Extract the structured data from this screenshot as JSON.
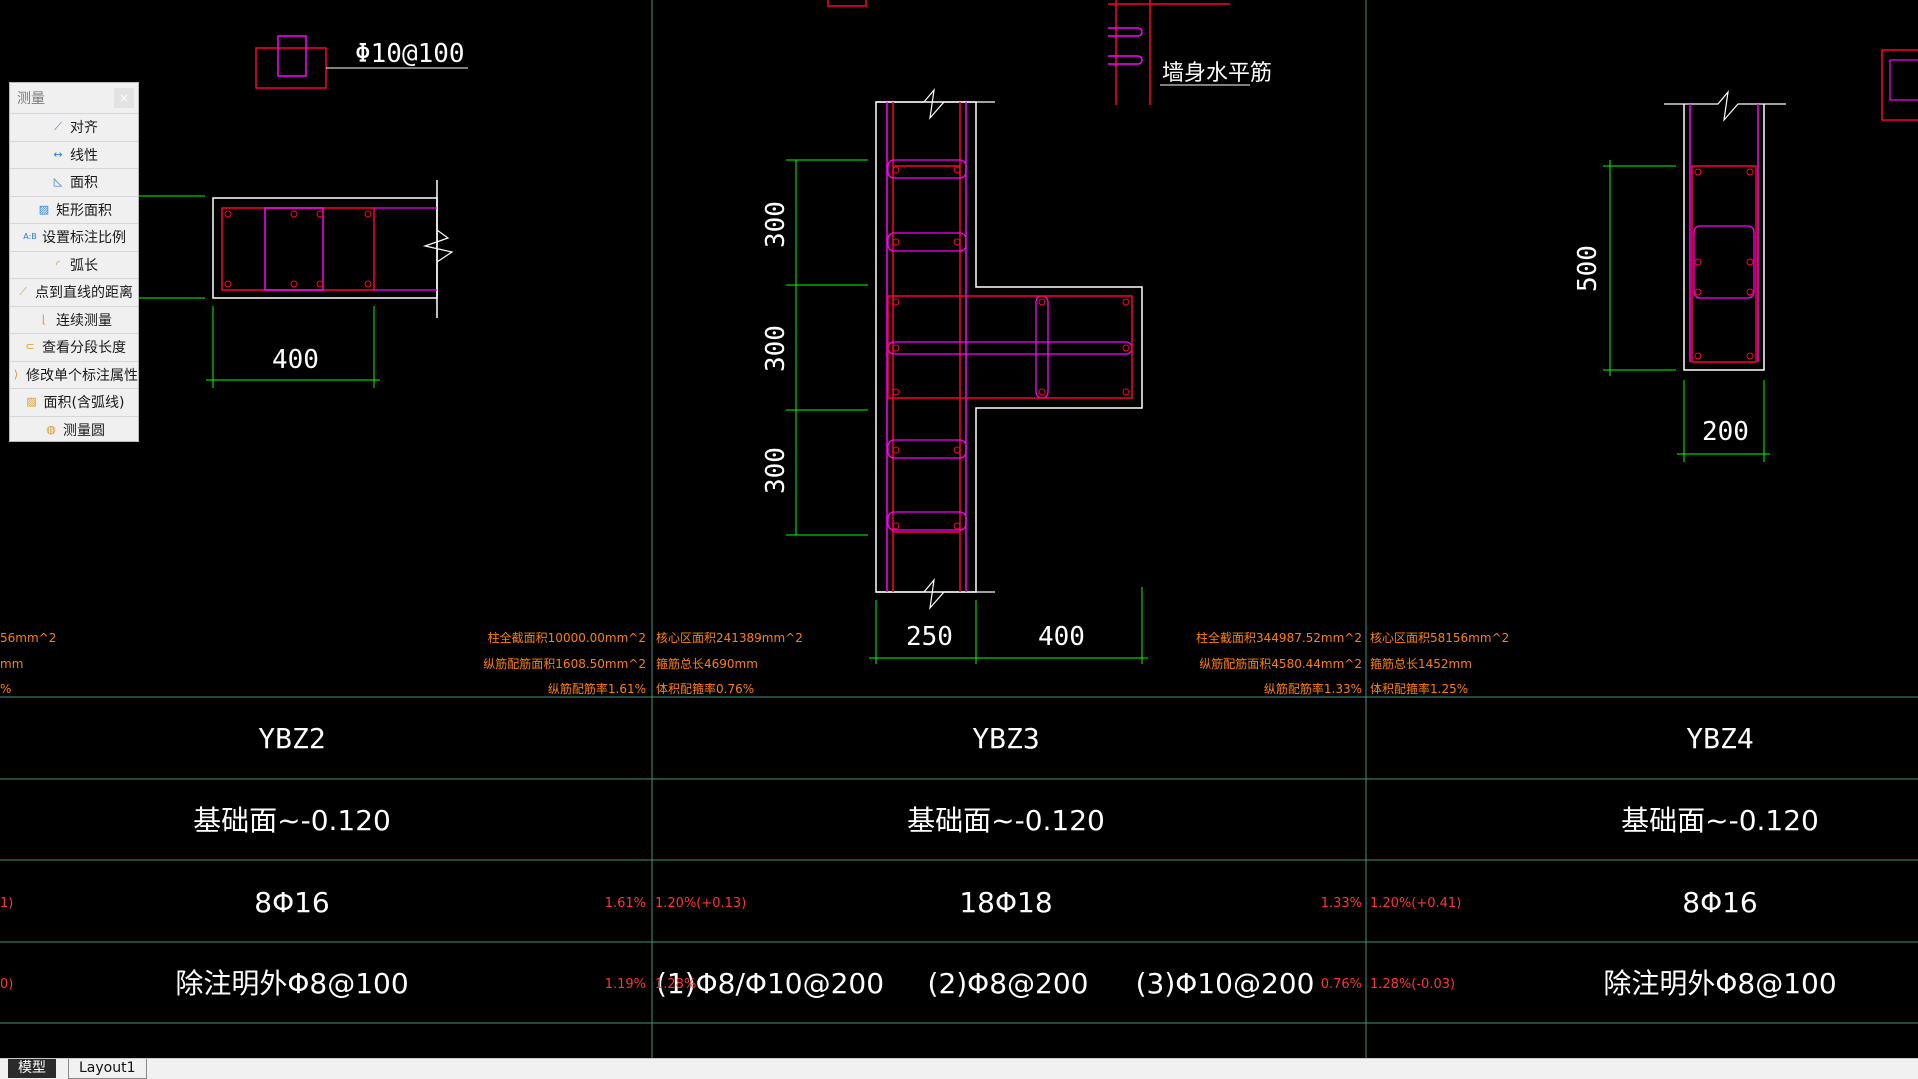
{
  "drawing": {
    "ybz2": {
      "dim_label": "Φ10@100",
      "width": "400",
      "stats": [
        "柱全截面积10000.00mm^2",
        "纵筋配筋面积1608.50mm^2",
        "纵筋配筋率1.61%"
      ]
    },
    "ybz3": {
      "dims": [
        "300",
        "300",
        "300",
        "250",
        "400"
      ],
      "stats_left": [
        "核心区面积241389mm^2",
        "箍筋总长4690mm",
        "体积配箍率0.76%"
      ],
      "note": "墙身水平筋",
      "stats": [
        "柱全截面积344987.52mm^2",
        "纵筋配筋面积4580.44mm^2",
        "纵筋配筋率1.33%"
      ]
    },
    "ybz4": {
      "dims": [
        "500",
        "200"
      ],
      "stats_left": [
        "核心区面积58156mm^2",
        "箍筋总长1452mm",
        "体积配箍率1.25%"
      ]
    },
    "left_edge": [
      "56mm^2",
      "mm",
      "%"
    ]
  },
  "table": {
    "names": [
      "YBZ2",
      "YBZ3",
      "YBZ4"
    ],
    "elevations": [
      "基础面~-0.120",
      "基础面~-0.120",
      "基础面~-0.120"
    ],
    "rebars": [
      "8Φ16",
      "18Φ18",
      "8Φ16"
    ],
    "stirrups": [
      "除注明外Φ8@100",
      "(1)Φ8/Φ10@200",
      "(2)Φ8@200",
      "(3)Φ10@200",
      "除注明外Φ8@100"
    ],
    "small_red": {
      "r3_a": "1.61%",
      "r3_b": "1.20%(+0.13)",
      "r3_c": "1.33%",
      "r3_d": "1.20%(+0.41)",
      "r4_a": "1.19%",
      "r4_b": "1.28%",
      "r4_c": "0.76%",
      "r4_d": "1.28%(-0.03)"
    },
    "edge_marks": [
      "1)",
      "0)"
    ]
  },
  "measure_panel": {
    "title": "测量",
    "close": "×",
    "items": [
      {
        "label": "对齐",
        "icon": "align-icon"
      },
      {
        "label": "线性",
        "icon": "linear-icon"
      },
      {
        "label": "面积",
        "icon": "area-icon"
      },
      {
        "label": "矩形面积",
        "icon": "rect-area-icon"
      },
      {
        "label": "设置标注比例",
        "icon": "scale-icon"
      },
      {
        "label": "弧长",
        "icon": "arc-icon"
      },
      {
        "label": "点到直线的距离",
        "icon": "point-line-icon"
      },
      {
        "label": "连续测量",
        "icon": "continuous-icon"
      },
      {
        "label": "查看分段长度",
        "icon": "segment-icon"
      },
      {
        "label": "修改单个标注属性",
        "icon": "edit-dim-icon"
      },
      {
        "label": "面积(含弧线)",
        "icon": "arc-area-icon"
      },
      {
        "label": "测量圆",
        "icon": "circle-icon"
      }
    ]
  },
  "tabs": {
    "model": "模型",
    "layout": "Layout1"
  },
  "colors": {
    "background": "#000000",
    "dim": "#00ff00",
    "outline": "#ffffff",
    "rebar": "#ff0033",
    "stirrup": "#ff00ff",
    "grid": "#3f8f7a",
    "stats": "#ff8000"
  }
}
